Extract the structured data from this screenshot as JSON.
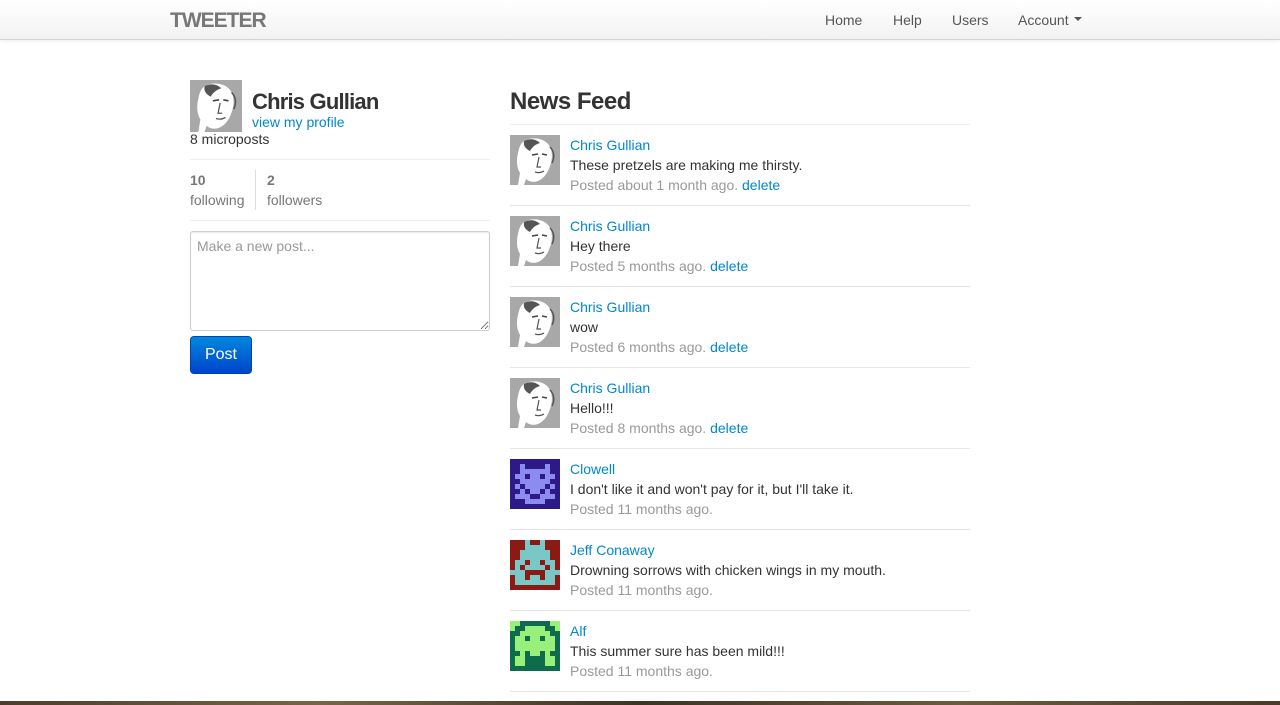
{
  "navbar": {
    "brand": "TWEETER",
    "items": [
      {
        "label": "Home"
      },
      {
        "label": "Help"
      },
      {
        "label": "Users"
      },
      {
        "label": "Account"
      }
    ]
  },
  "profile": {
    "name": "Chris Gullian",
    "profile_link": "view my profile",
    "micropost_count": "8 microposts",
    "following_count": "10",
    "following_label": "following",
    "followers_count": "2",
    "followers_label": "followers"
  },
  "composer": {
    "placeholder": "Make a new post...",
    "post_label": "Post"
  },
  "feed": {
    "title": "News Feed",
    "items": [
      {
        "name": "Chris Gullian",
        "content": "These pretzels are making me thirsty.",
        "meta": "Posted about 1 month ago.",
        "delete": "delete",
        "avatar": "face"
      },
      {
        "name": "Chris Gullian",
        "content": "Hey there",
        "meta": "Posted 5 months ago.",
        "delete": "delete",
        "avatar": "face"
      },
      {
        "name": "Chris Gullian",
        "content": "wow",
        "meta": "Posted 6 months ago.",
        "delete": "delete",
        "avatar": "face"
      },
      {
        "name": "Chris Gullian",
        "content": "Hello!!!",
        "meta": "Posted 8 months ago.",
        "delete": "delete",
        "avatar": "face"
      },
      {
        "name": "Clowell",
        "content": "I don't like it and won't pay for it, but I'll take it.",
        "meta": "Posted 11 months ago.",
        "avatar": "pixel-purple"
      },
      {
        "name": "Jeff Conaway",
        "content": "Drowning sorrows with chicken wings in my mouth.",
        "meta": "Posted 11 months ago.",
        "avatar": "pixel-red"
      },
      {
        "name": "Alf",
        "content": "This summer sure has been mild!!!",
        "meta": "Posted 11 months ago.",
        "avatar": "pixel-green"
      }
    ]
  },
  "colors": {
    "link": "#0088cc",
    "muted": "#999999",
    "button": "#0066cc",
    "pixel_purple_bg": "#2e1a86",
    "pixel_purple_fg": "#8c8cf0",
    "pixel_red_bg": "#8c1a14",
    "pixel_red_fg": "#78c8c8",
    "pixel_green_bg": "#0e6b4c",
    "pixel_green_fg": "#96f07a"
  }
}
